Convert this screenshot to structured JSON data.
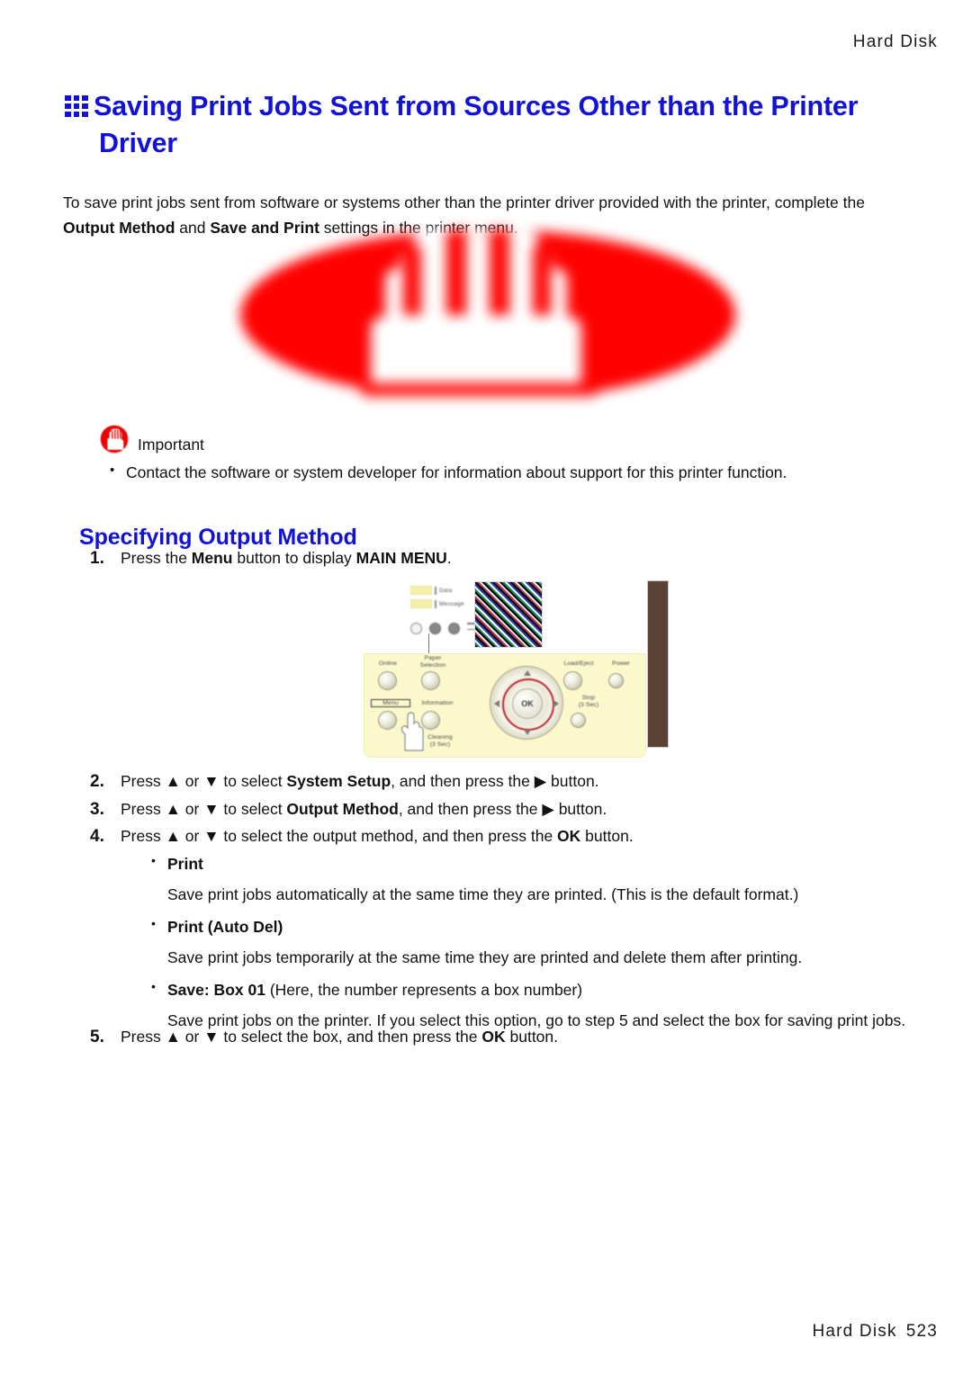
{
  "running_head": "Hard Disk",
  "chapter": {
    "icon": "grid-3x3-icon",
    "title": "Saving Print Jobs Sent from Sources Other than the Printer Driver",
    "title_color": "#1111d8"
  },
  "intro": {
    "line1_before": "To save print jobs sent from software or systems other than the printer driver provided with the printer, complete the ",
    "bold1": "Output Method",
    "mid": " and ",
    "bold2": "Save and Print",
    "after": " settings in the printer menu."
  },
  "big_graphic": {
    "name": "important-hand-symbol-enlarged",
    "color": "#ff0000",
    "description": "Large blurred red ellipse containing a white raised-hand (stop) symbol"
  },
  "important": {
    "icon": "important-hand-icon",
    "icon_color": "#ee0000",
    "label": "Important",
    "bullets": [
      "Contact the software or system developer for information about support for this printer function."
    ]
  },
  "section": {
    "heading": "Specifying Output Method",
    "heading_color": "#1111d8"
  },
  "steps": [
    {
      "num": "1.",
      "before": "Press the ",
      "bold": "Menu",
      "mid": " button to display ",
      "bold2": "MAIN MENU",
      "after": "."
    },
    {
      "num": "2.",
      "before": "Press ▲ or ▼ to select ",
      "bold": "System Setup",
      "mid": ", and then press the ▶ button.",
      "bold2": "",
      "after": ""
    },
    {
      "num": "3.",
      "before": "Press ▲ or ▼ to select ",
      "bold": "Output Method",
      "mid": ", and then press the ▶ button.",
      "bold2": "",
      "after": ""
    },
    {
      "num": "4.",
      "before": "Press ▲ or ▼ to select the output method, and then press the ",
      "bold": "OK",
      "mid": " button.",
      "bold2": "",
      "after": ""
    }
  ],
  "panel_figure": {
    "name": "printer-control-panel-illustration",
    "lamps": [
      {
        "label": "Data"
      },
      {
        "label": "Message"
      }
    ],
    "display_name": "lcd-display",
    "buttons": [
      {
        "label": "Online"
      },
      {
        "label": "Paper\nSelection"
      },
      {
        "label": "Load/Eject"
      },
      {
        "label": "Power"
      },
      {
        "label": "Menu"
      },
      {
        "label": "Information"
      },
      {
        "label": "Stop\n(3 Sec)"
      },
      {
        "label": "Cleaning\n(3 Sec)"
      }
    ],
    "labels": {
      "online": "Online",
      "paper_selection_l1": "Paper",
      "paper_selection_l2": "Selection",
      "load_eject": "Load/Eject",
      "power": "Power",
      "menu": "Menu",
      "information": "Information",
      "stop_l1": "Stop",
      "stop_l2": "(3 Sec)",
      "cleaning_l1": "Cleaning",
      "cleaning_l2": "(3 Sec)"
    },
    "ok_label": "OK",
    "panel_color": "#fbf8cc",
    "accent_ring_color": "#c02233",
    "side_bar_color": "#5a4334"
  },
  "output_methods": [
    {
      "name": "Print",
      "suffix": "",
      "description": "Save print jobs automatically at the same time they are printed. (This is the default format.)"
    },
    {
      "name": "Print (Auto Del)",
      "suffix": "",
      "description": "Save print jobs temporarily at the same time they are printed and delete them after printing."
    },
    {
      "name": "Save: Box 01",
      "suffix": " (Here, the number represents a box number)",
      "description": "Save print jobs on the printer. If you select this option, go to step 5 and select the box for saving print jobs."
    }
  ],
  "step5": {
    "num": "5.",
    "before": "Press ▲ or ▼ to select the box, and then press the ",
    "bold": "OK",
    "after": " button."
  },
  "footer": {
    "title": "Hard Disk",
    "page": "523"
  }
}
